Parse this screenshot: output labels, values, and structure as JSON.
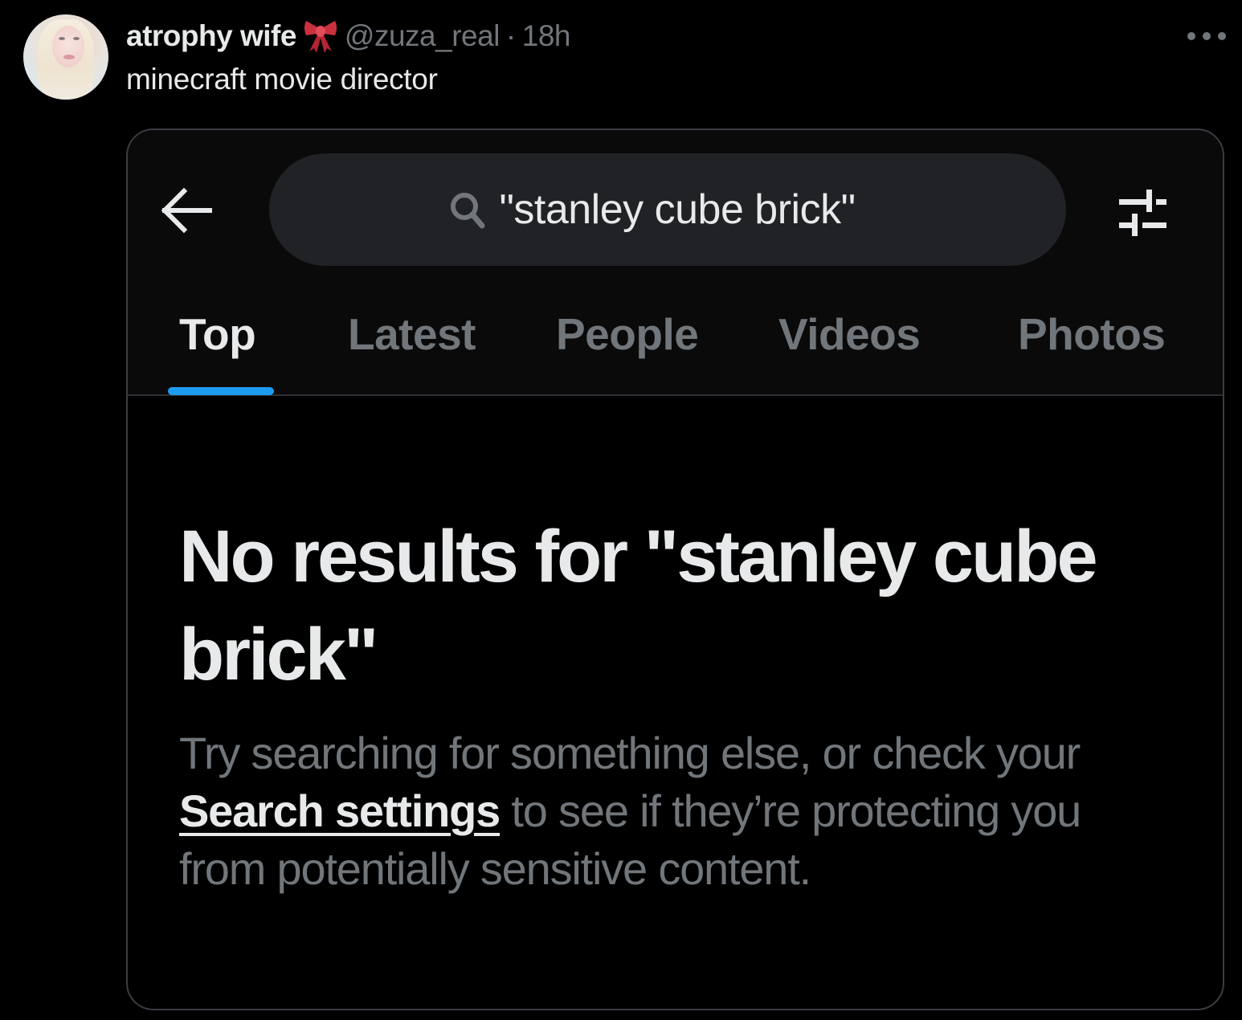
{
  "tweet": {
    "author": {
      "display_name": "atrophy wife",
      "name_emoji": "ribbon-bow",
      "handle": "@zuza_real",
      "separator": "·",
      "timestamp": "18h"
    },
    "text": "minecraft movie director",
    "more_icon": "more-horizontal-icon"
  },
  "screenshot": {
    "back_icon": "arrow-left-icon",
    "search": {
      "icon": "search-icon",
      "value": "\"stanley cube brick\""
    },
    "filter_icon": "sliders-icon",
    "tabs": [
      {
        "label": "Top",
        "active": true
      },
      {
        "label": "Latest",
        "active": false
      },
      {
        "label": "People",
        "active": false
      },
      {
        "label": "Videos",
        "active": false
      },
      {
        "label": "Photos",
        "active": false
      }
    ],
    "colors": {
      "accent": "#1d9bf0",
      "text_primary": "#e7e9ea",
      "text_secondary": "#71767b",
      "search_bg": "#202226"
    },
    "empty_state": {
      "title": "No results for \"stanley cube brick\"",
      "body_before": "Try searching for something else, or check your ",
      "link": "Search settings",
      "body_after": " to see if they’re protecting you from potentially sensitive content."
    }
  }
}
